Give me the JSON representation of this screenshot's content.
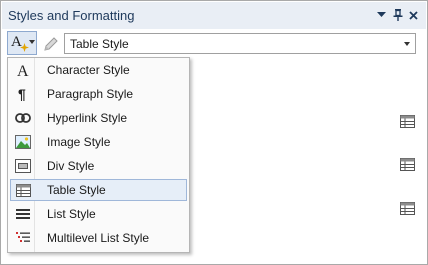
{
  "panel": {
    "title": "Styles and Formatting",
    "dropdown_icon": "chevron-down-icon",
    "pin_icon": "pin-icon",
    "close_icon": "close-icon"
  },
  "toolbar": {
    "style_type_icon": "character-style-icon",
    "style_type_glyph": "A",
    "pencil_icon": "pencil-icon",
    "style_combo_value": "Table Style"
  },
  "menu": {
    "items": [
      {
        "label": "Character Style",
        "icon": "character-style-icon",
        "selected": false
      },
      {
        "label": "Paragraph Style",
        "icon": "paragraph-style-icon",
        "selected": false
      },
      {
        "label": "Hyperlink Style",
        "icon": "hyperlink-style-icon",
        "selected": false
      },
      {
        "label": "Image Style",
        "icon": "image-style-icon",
        "selected": false
      },
      {
        "label": "Div Style",
        "icon": "div-style-icon",
        "selected": false
      },
      {
        "label": "Table Style",
        "icon": "table-style-icon",
        "selected": true
      },
      {
        "label": "List Style",
        "icon": "list-style-icon",
        "selected": false
      },
      {
        "label": "Multilevel List Style",
        "icon": "multilevel-list-style-icon",
        "selected": false
      }
    ]
  },
  "style_list": {
    "row_icon": "table-style-icon"
  },
  "colors": {
    "title_bar": "#e9eef5",
    "title_text": "#1e395b",
    "selection_fill": "#e6eef8",
    "selection_border": "#9fb7d9"
  }
}
